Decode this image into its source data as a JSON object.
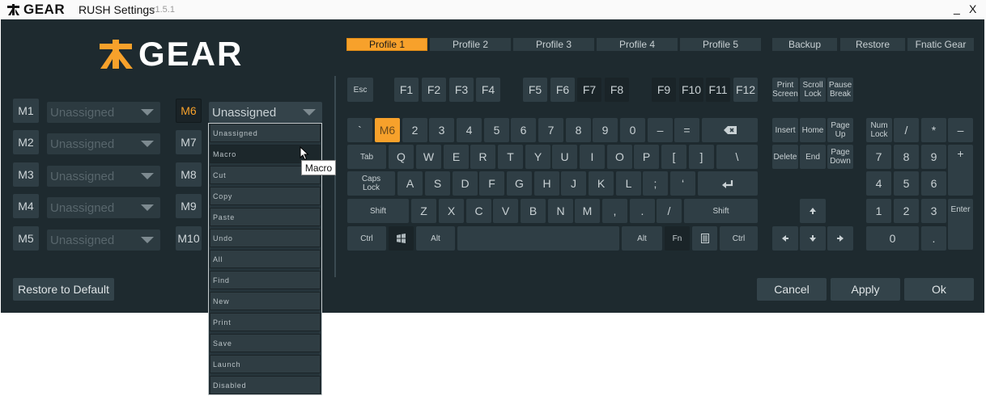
{
  "window": {
    "brand": "GEAR",
    "title": "RUSH Settings",
    "version": "v1.5.1",
    "minimize": "_",
    "close": "X"
  },
  "logo": {
    "word": "GEAR"
  },
  "macro_rows": [
    {
      "key": "M1",
      "value": "Unassigned"
    },
    {
      "key": "M2",
      "value": "Unassigned"
    },
    {
      "key": "M3",
      "value": "Unassigned"
    },
    {
      "key": "M4",
      "value": "Unassigned"
    },
    {
      "key": "M5",
      "value": "Unassigned"
    },
    {
      "key": "M6",
      "value": "Unassigned"
    },
    {
      "key": "M7",
      "value": ""
    },
    {
      "key": "M8",
      "value": ""
    },
    {
      "key": "M9",
      "value": ""
    },
    {
      "key": "M10",
      "value": ""
    }
  ],
  "dropdown_options": [
    "Unassigned",
    "Macro",
    "Cut",
    "Copy",
    "Paste",
    "Undo",
    "All",
    "Find",
    "New",
    "Print",
    "Save",
    "Launch",
    "Disabled"
  ],
  "tooltip": "Macro",
  "profiles": [
    "Profile 1",
    "Profile 2",
    "Profile 3",
    "Profile 4",
    "Profile 5"
  ],
  "actions": {
    "backup": "Backup",
    "restore": "Restore",
    "fnatic_gear": "Fnatic Gear"
  },
  "footer": {
    "restore_default": "Restore to Default",
    "cancel": "Cancel",
    "apply": "Apply",
    "ok": "Ok"
  },
  "keyboard": {
    "esc": "Esc",
    "f1": "F1",
    "f2": "F2",
    "f3": "F3",
    "f4": "F4",
    "f5": "F5",
    "f6": "F6",
    "f7": "F7",
    "f8": "F8",
    "f9": "F9",
    "f10": "F10",
    "f11": "F11",
    "f12": "F12",
    "prtsc_1": "Print",
    "prtsc_2": "Screen",
    "scroll_1": "Scroll",
    "scroll_2": "Lock",
    "pause_1": "Pause",
    "pause_2": "Break",
    "backtick": "`",
    "m6": "M6",
    "n1": "2",
    "n2": "3",
    "n3": "4",
    "n4": "5",
    "n5": "6",
    "n6": "7",
    "n7": "8",
    "n8": "9",
    "n9": "0",
    "minus": "–",
    "equals": "=",
    "tab": "Tab",
    "q": "Q",
    "w": "W",
    "e": "E",
    "r": "R",
    "t": "T",
    "y": "Y",
    "u": "U",
    "i": "I",
    "o": "O",
    "p": "P",
    "lbracket": "[",
    "rbracket": "]",
    "backslash": "\\",
    "caps_1": "Caps",
    "caps_2": "Lock",
    "a": "A",
    "s": "S",
    "d": "D",
    "f": "F",
    "g": "G",
    "h": "H",
    "j": "J",
    "k": "K",
    "l": "L",
    "semicolon": ";",
    "quote": "‘",
    "lshift": "Shift",
    "z": "Z",
    "x": "X",
    "c": "C",
    "v": "V",
    "b": "B",
    "n": "N",
    "m": "M",
    "comma": ",",
    "period": ".",
    "slash": "/",
    "rshift": "Shift",
    "lctrl": "Ctrl",
    "lalt": "Alt",
    "ralt": "Alt",
    "fn": "Fn",
    "rctrl": "Ctrl",
    "insert": "Insert",
    "home": "Home",
    "pgup_1": "Page",
    "pgup_2": "Up",
    "delete": "Delete",
    "end": "End",
    "pgdn_1": "Page",
    "pgdn_2": "Down",
    "numlock_1": "Num",
    "numlock_2": "Lock",
    "np_div": "/",
    "np_mul": "*",
    "np_sub": "–",
    "np7": "7",
    "np8": "8",
    "np9": "9",
    "np_add": "+",
    "np4": "4",
    "np5": "5",
    "np6": "6",
    "np1": "1",
    "np2": "2",
    "np3": "3",
    "np_enter": "Enter",
    "np0": "0",
    "np_dot": "."
  },
  "colors": {
    "accent": "#f7a12b",
    "background": "#1e2a2f",
    "key": "#2f3e45"
  }
}
